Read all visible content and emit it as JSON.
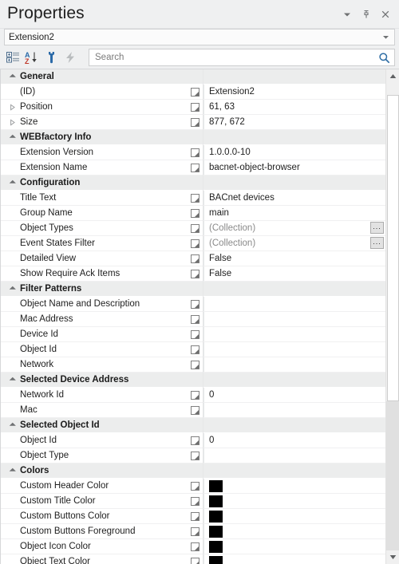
{
  "window": {
    "title": "Properties",
    "actions": [
      {
        "name": "dropdown-menu-icon",
        "glyph": "chevron-down"
      },
      {
        "name": "pin-icon",
        "glyph": "pin"
      },
      {
        "name": "close-icon",
        "glyph": "close"
      }
    ]
  },
  "object_selector": {
    "value": "Extension2",
    "arrow": "chevron-down"
  },
  "toolbar": {
    "buttons": [
      {
        "name": "categorized-view-button",
        "icon": "categorized-icon",
        "title": "Categorized"
      },
      {
        "name": "alphabetical-sort-button",
        "icon": "sort-az-icon",
        "title": "Alphabetical"
      },
      {
        "name": "properties-button",
        "icon": "wrench-icon",
        "title": "Properties"
      },
      {
        "name": "events-button",
        "icon": "lightning-bolt-icon",
        "title": "Events"
      }
    ]
  },
  "search": {
    "value": "",
    "placeholder": "Search",
    "icon": "search-icon"
  },
  "colors": {
    "panel_bg": "#eff0f1",
    "grid_bg": "#ffffff",
    "section_bg": "#eceded",
    "text": "#1e1e1e",
    "muted_text": "#8a8a8a",
    "accent_blue": "#2e6da4",
    "swatch_black": "#000000"
  },
  "scrollbar": {
    "up_arrow": "scroll-up-icon",
    "down_arrow": "scroll-down-icon",
    "thumb_top_pct": 2.6,
    "thumb_height_pct": 65.5
  },
  "grid": {
    "sections": [
      {
        "name": "General",
        "expanded": true,
        "rows": [
          {
            "label": "(ID)",
            "value": "Extension2",
            "bindable": true,
            "expandable": false,
            "kind": "text"
          },
          {
            "label": "Position",
            "value": "61, 63",
            "bindable": true,
            "expandable": true,
            "kind": "text"
          },
          {
            "label": "Size",
            "value": "877, 672",
            "bindable": true,
            "expandable": true,
            "kind": "text"
          }
        ]
      },
      {
        "name": "WEBfactory Info",
        "expanded": true,
        "rows": [
          {
            "label": "Extension Version",
            "value": "1.0.0.0-10",
            "bindable": true,
            "expandable": false,
            "kind": "text"
          },
          {
            "label": "Extension Name",
            "value": "bacnet-object-browser",
            "bindable": true,
            "expandable": false,
            "kind": "text"
          }
        ]
      },
      {
        "name": "Configuration",
        "expanded": true,
        "rows": [
          {
            "label": "Title Text",
            "value": "BACnet devices",
            "bindable": true,
            "expandable": false,
            "kind": "text"
          },
          {
            "label": "Group Name",
            "value": "main",
            "bindable": true,
            "expandable": false,
            "kind": "text"
          },
          {
            "label": "Object Types",
            "value": "(Collection)",
            "bindable": true,
            "expandable": false,
            "kind": "collection",
            "ellipsis": "..."
          },
          {
            "label": "Event States Filter",
            "value": "(Collection)",
            "bindable": true,
            "expandable": false,
            "kind": "collection",
            "ellipsis": "..."
          },
          {
            "label": "Detailed View",
            "value": "False",
            "bindable": true,
            "expandable": false,
            "kind": "text"
          },
          {
            "label": "Show Require Ack Items",
            "value": "False",
            "bindable": true,
            "expandable": false,
            "kind": "text"
          }
        ]
      },
      {
        "name": "Filter Patterns",
        "expanded": true,
        "rows": [
          {
            "label": "Object Name and Description",
            "value": "",
            "bindable": true,
            "expandable": false,
            "kind": "text"
          },
          {
            "label": "Mac Address",
            "value": "",
            "bindable": true,
            "expandable": false,
            "kind": "text"
          },
          {
            "label": "Device Id",
            "value": "",
            "bindable": true,
            "expandable": false,
            "kind": "text"
          },
          {
            "label": "Object Id",
            "value": "",
            "bindable": true,
            "expandable": false,
            "kind": "text"
          },
          {
            "label": "Network",
            "value": "",
            "bindable": true,
            "expandable": false,
            "kind": "text"
          }
        ]
      },
      {
        "name": "Selected Device Address",
        "expanded": true,
        "rows": [
          {
            "label": "Network Id",
            "value": "0",
            "bindable": true,
            "expandable": false,
            "kind": "text"
          },
          {
            "label": "Mac",
            "value": "",
            "bindable": true,
            "expandable": false,
            "kind": "text"
          }
        ]
      },
      {
        "name": "Selected Object Id",
        "expanded": true,
        "rows": [
          {
            "label": "Object Id",
            "value": "0",
            "bindable": true,
            "expandable": false,
            "kind": "text"
          },
          {
            "label": "Object Type",
            "value": "",
            "bindable": true,
            "expandable": false,
            "kind": "text"
          }
        ]
      },
      {
        "name": "Colors",
        "expanded": true,
        "rows": [
          {
            "label": "Custom Header Color",
            "value": "",
            "bindable": true,
            "expandable": false,
            "kind": "color",
            "swatch": "#000000"
          },
          {
            "label": "Custom Title Color",
            "value": "",
            "bindable": true,
            "expandable": false,
            "kind": "color",
            "swatch": "#000000"
          },
          {
            "label": "Custom Buttons Color",
            "value": "",
            "bindable": true,
            "expandable": false,
            "kind": "color",
            "swatch": "#000000"
          },
          {
            "label": "Custom Buttons Foreground",
            "value": "",
            "bindable": true,
            "expandable": false,
            "kind": "color",
            "swatch": "#000000"
          },
          {
            "label": "Object Icon Color",
            "value": "",
            "bindable": true,
            "expandable": false,
            "kind": "color",
            "swatch": "#000000"
          },
          {
            "label": "Object Text Color",
            "value": "",
            "bindable": true,
            "expandable": false,
            "kind": "color",
            "swatch": "#000000"
          }
        ]
      }
    ]
  }
}
